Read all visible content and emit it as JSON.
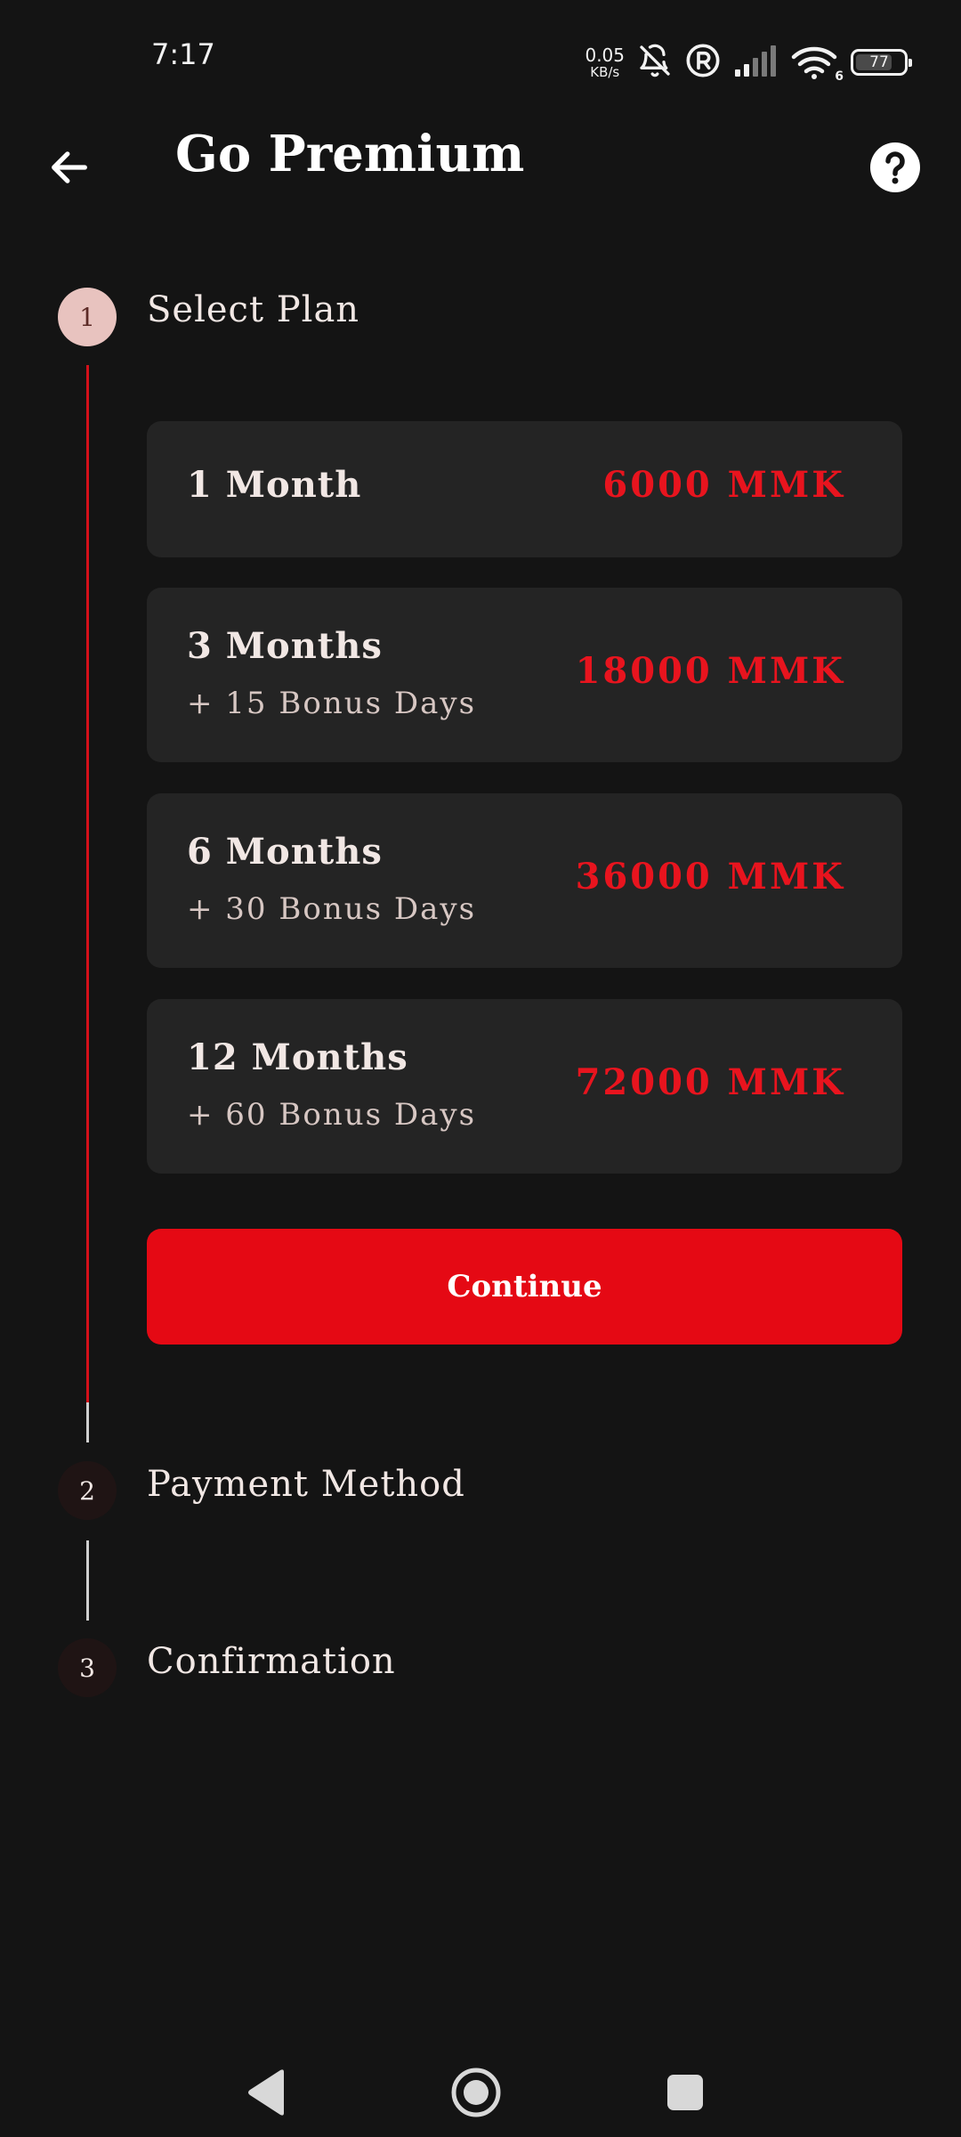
{
  "status_bar": {
    "time": "7:17",
    "net_speed_value": "0.05",
    "net_speed_unit": "KB/s",
    "wifi_badge": "6",
    "battery_level": "77",
    "battery_fraction": 0.77,
    "icons": [
      "bell-off-icon",
      "registered-icon",
      "signal-icon",
      "wifi-icon",
      "battery-icon"
    ]
  },
  "app_bar": {
    "title": "Go Premium",
    "back_icon": "arrow-left-icon",
    "help_icon": "help-circle-icon"
  },
  "stepper": {
    "steps": [
      {
        "number": "1",
        "title": "Select Plan",
        "state": "active"
      },
      {
        "number": "2",
        "title": "Payment Method",
        "state": "inactive"
      },
      {
        "number": "3",
        "title": "Confirmation",
        "state": "inactive"
      }
    ]
  },
  "plans": [
    {
      "name": "1 Month",
      "bonus": "",
      "price": "6000 MMK"
    },
    {
      "name": "3 Months",
      "bonus": "+ 15 Bonus Days",
      "price": "18000 MMK"
    },
    {
      "name": "6 Months",
      "bonus": "+ 30 Bonus Days",
      "price": "36000 MMK"
    },
    {
      "name": "12 Months",
      "bonus": "+ 60 Bonus Days",
      "price": "72000 MMK"
    }
  ],
  "continue_label": "Continue",
  "colors": {
    "background": "#141414",
    "card": "#242424",
    "accent": "#e50914",
    "price": "#e8141e",
    "step_active": "#e8c3bf"
  },
  "nav_bar": {
    "icons": [
      "nav-back-icon",
      "nav-home-icon",
      "nav-recents-icon"
    ]
  }
}
